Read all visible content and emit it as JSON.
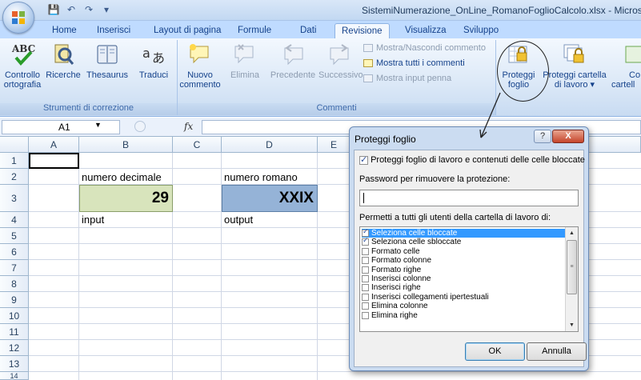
{
  "window": {
    "title": "SistemiNumerazione_OnLine_RomanoFoglioCalcolo.xlsx - Microso",
    "qat_icons": [
      "save-icon",
      "undo-icon",
      "redo-icon",
      "qat-dropdown-icon"
    ]
  },
  "tabs": [
    "Home",
    "Inserisci",
    "Layout di pagina",
    "Formule",
    "Dati",
    "Revisione",
    "Visualizza",
    "Sviluppo"
  ],
  "active_tab": "Revisione",
  "ribbon": {
    "correction_group": {
      "label": "Strumenti di correzione",
      "buttons": [
        {
          "line1": "Controllo",
          "line2": "ortografia",
          "icon": "spelling-icon"
        },
        {
          "line1": "Ricerche",
          "line2": "",
          "icon": "research-icon"
        },
        {
          "line1": "Thesaurus",
          "line2": "",
          "icon": "thesaurus-icon"
        },
        {
          "line1": "Traduci",
          "line2": "",
          "icon": "translate-icon"
        }
      ]
    },
    "comments_group": {
      "label": "Commenti",
      "buttons": [
        {
          "line1": "Nuovo",
          "line2": "commento",
          "icon": "new-comment-icon",
          "enabled": true
        },
        {
          "line1": "Elimina",
          "line2": "",
          "icon": "delete-comment-icon",
          "enabled": false
        },
        {
          "line1": "Precedente",
          "line2": "",
          "icon": "previous-comment-icon",
          "enabled": false
        },
        {
          "line1": "Successivo",
          "line2": "",
          "icon": "next-comment-icon",
          "enabled": false
        }
      ],
      "small": [
        {
          "label": "Mostra/Nascondi commento",
          "enabled": false
        },
        {
          "label": "Mostra tutti i commenti",
          "enabled": true
        },
        {
          "label": "Mostra input penna",
          "enabled": false
        }
      ]
    },
    "changes_group": {
      "buttons": [
        {
          "line1": "Proteggi",
          "line2": "foglio",
          "icon": "protect-sheet-icon"
        },
        {
          "line1": "Proteggi cartella",
          "line2": "di lavoro ▾",
          "icon": "protect-workbook-icon"
        },
        {
          "line1": "Co",
          "line2": "cartell",
          "icon": "share-workbook-icon"
        }
      ]
    }
  },
  "formula_bar": {
    "name_box": "A1",
    "fx": "fx",
    "value": ""
  },
  "sheet": {
    "columns": [
      "A",
      "B",
      "C",
      "D",
      "E"
    ],
    "rows": [
      "1",
      "2",
      "3",
      "4",
      "5",
      "6",
      "7",
      "8",
      "9",
      "10",
      "11",
      "12",
      "13",
      "14"
    ],
    "cells": {
      "b2": "numero decimale",
      "d2": "numero romano",
      "b3": "29",
      "d3": "XXIX",
      "b4": "input",
      "d4": "output"
    },
    "colors": {
      "input_fill": "#d8e4bc",
      "output_fill": "#95b3d7"
    }
  },
  "dialog": {
    "title": "Proteggi foglio",
    "help": "?",
    "close": "X",
    "protect_checkbox": {
      "label": "Proteggi foglio di lavoro e contenuti delle celle bloccate",
      "checked": true
    },
    "password_label": "Password per rimuovere la protezione:",
    "password_value": "",
    "permissions_label": "Permetti a tutti gli utenti della cartella di lavoro di:",
    "permissions": [
      {
        "label": "Seleziona celle bloccate",
        "checked": true,
        "selected": true
      },
      {
        "label": "Seleziona celle sbloccate",
        "checked": true,
        "selected": false
      },
      {
        "label": "Formato celle",
        "checked": false,
        "selected": false
      },
      {
        "label": "Formato colonne",
        "checked": false,
        "selected": false
      },
      {
        "label": "Formato righe",
        "checked": false,
        "selected": false
      },
      {
        "label": "Inserisci colonne",
        "checked": false,
        "selected": false
      },
      {
        "label": "Inserisci righe",
        "checked": false,
        "selected": false
      },
      {
        "label": "Inserisci collegamenti ipertestuali",
        "checked": false,
        "selected": false
      },
      {
        "label": "Elimina colonne",
        "checked": false,
        "selected": false
      },
      {
        "label": "Elimina righe",
        "checked": false,
        "selected": false
      }
    ],
    "ok": "OK",
    "cancel": "Annulla"
  }
}
